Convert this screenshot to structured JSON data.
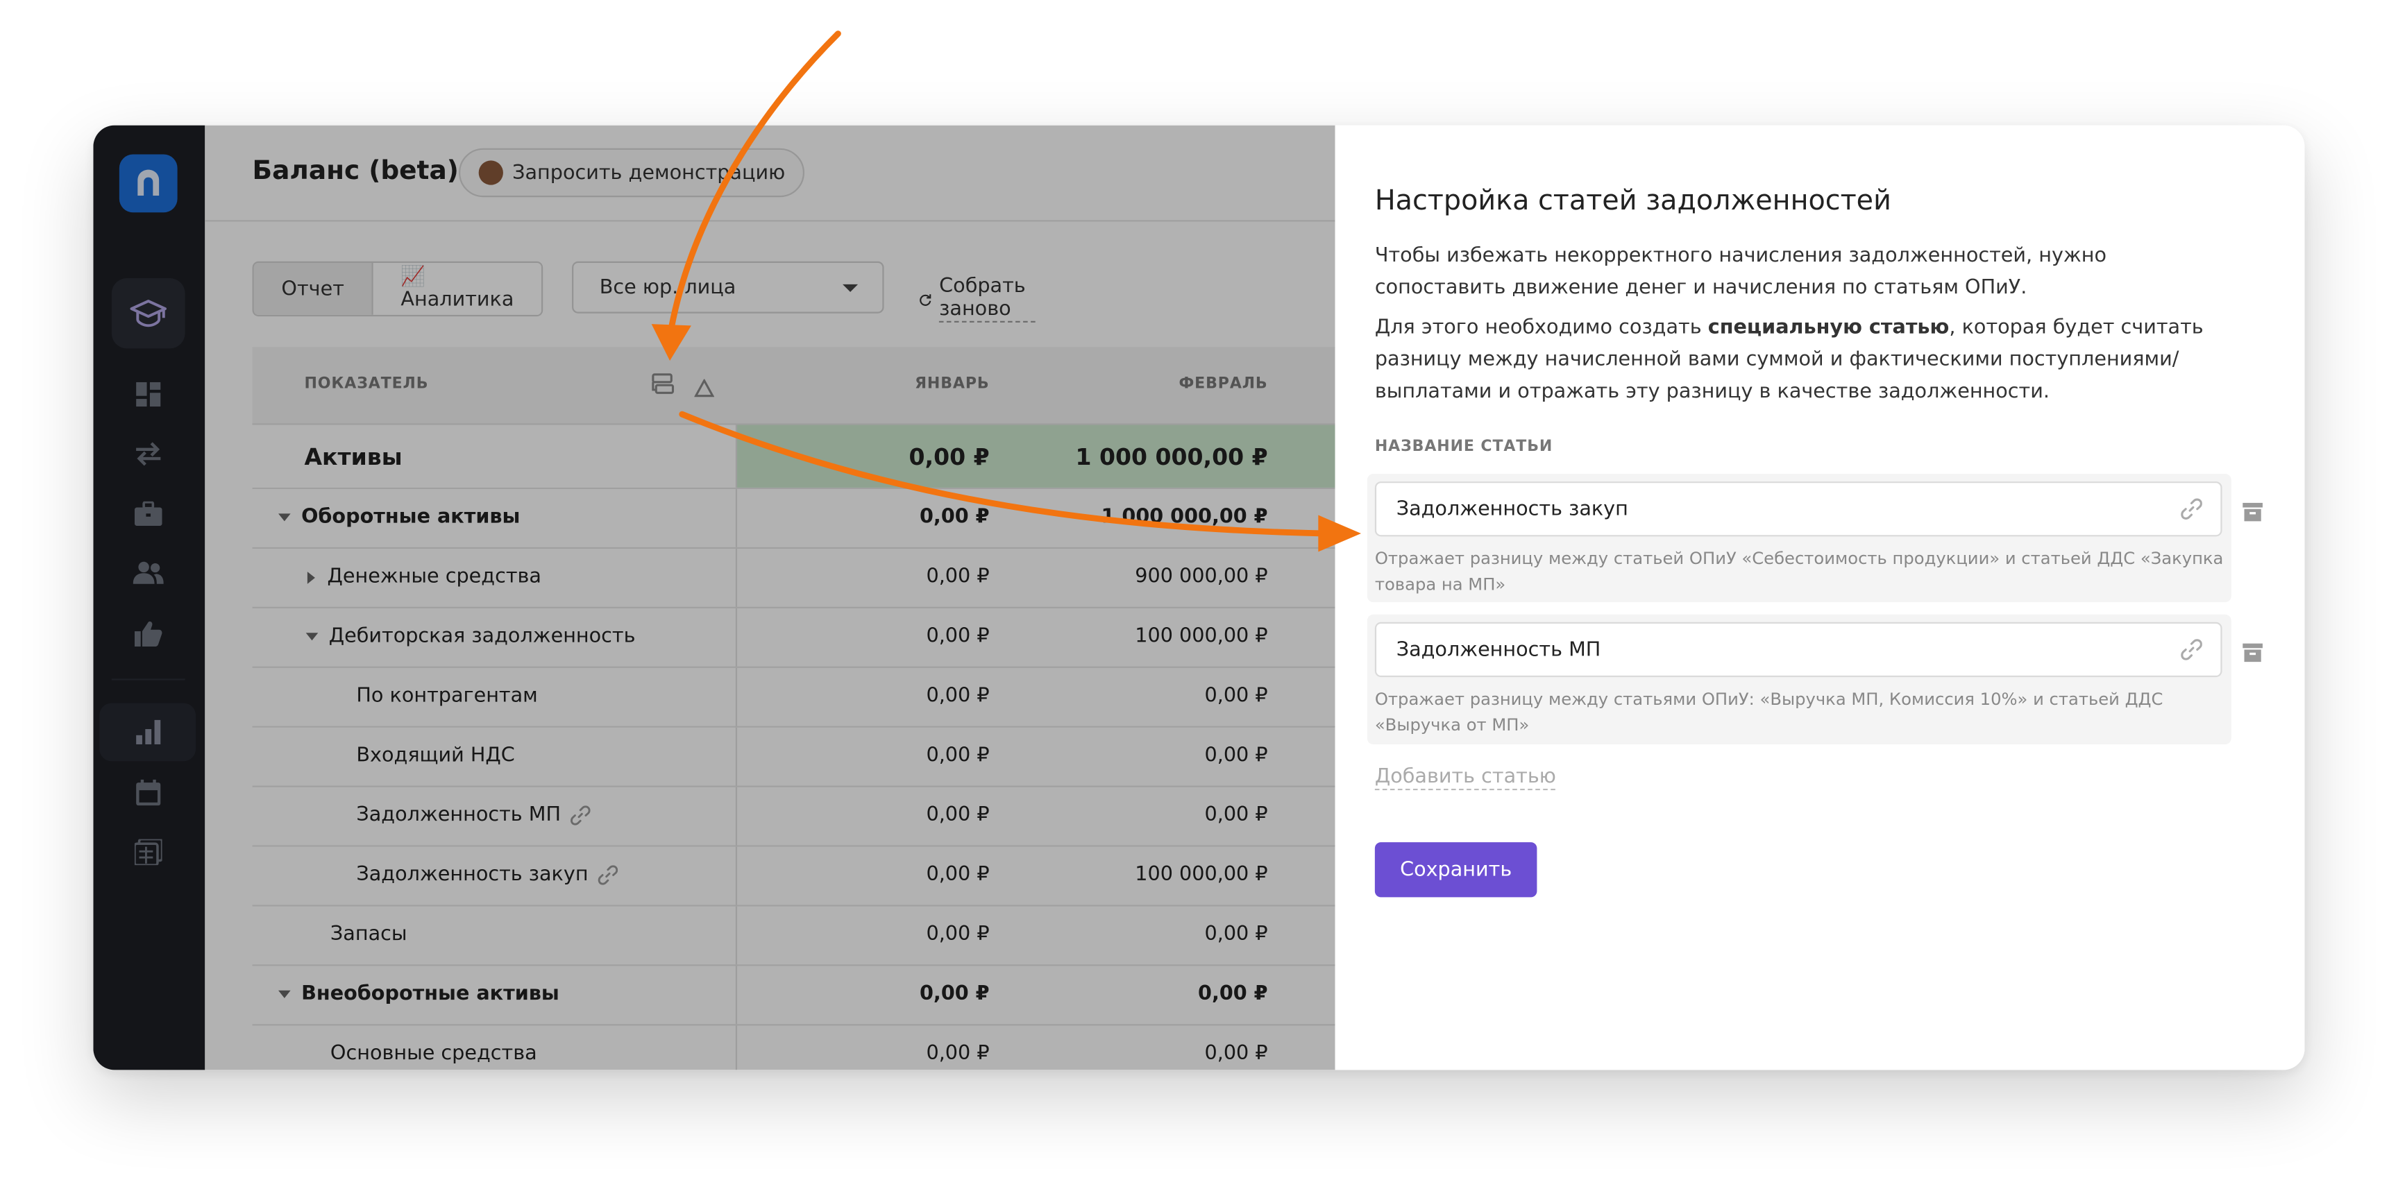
{
  "app": {
    "title": "Баланс (beta)",
    "demo_button": "Запросить демонстрацию"
  },
  "toolbar": {
    "tabs": [
      "Отчет",
      "📈 Аналитика"
    ],
    "entity_select": "Все юр. лица",
    "rebuild": "Собрать заново"
  },
  "table": {
    "headers": {
      "indicator": "ПОКАЗАТЕЛЬ",
      "col1": "ЯНВАРЬ",
      "col2": "ФЕВРАЛЬ"
    },
    "rows": [
      {
        "label": "Активы",
        "v1": "0,00 ₽",
        "v2": "1 000 000,00 ₽"
      },
      {
        "label": "Оборотные активы",
        "v1": "0,00 ₽",
        "v2": "1 000 000,00 ₽"
      },
      {
        "label": "Денежные средства",
        "v1": "0,00 ₽",
        "v2": "900 000,00 ₽"
      },
      {
        "label": "Дебиторская задолженность",
        "v1": "0,00 ₽",
        "v2": "100 000,00 ₽"
      },
      {
        "label": "По контрагентам",
        "v1": "0,00 ₽",
        "v2": "0,00 ₽"
      },
      {
        "label": "Входящий НДС",
        "v1": "0,00 ₽",
        "v2": "0,00 ₽"
      },
      {
        "label": "Задолженность МП",
        "v1": "0,00 ₽",
        "v2": "0,00 ₽"
      },
      {
        "label": "Задолженность закуп",
        "v1": "0,00 ₽",
        "v2": "100 000,00 ₽"
      },
      {
        "label": "Запасы",
        "v1": "0,00 ₽",
        "v2": "0,00 ₽"
      },
      {
        "label": "Внеоборотные активы",
        "v1": "0,00 ₽",
        "v2": "0,00 ₽"
      },
      {
        "label": "Основные средства",
        "v1": "0,00 ₽",
        "v2": "0,00 ₽"
      }
    ]
  },
  "panel": {
    "title": "Настройка статей задолженностей",
    "desc1": "Чтобы избежать некорректного начисления задолженностей, нужно сопоставить движение денег и начисления по статьям ОПиУ.",
    "desc2_pre": "Для этого необходимо создать ",
    "desc2_bold": "специальную статью",
    "desc2_post": ", которая будет считать разницу между начисленной вами суммой и фактическими поступлениями/выплатами и отражать эту разницу в качестве задолженности.",
    "field_label": "НАЗВАНИЕ СТАТЬИ",
    "items": [
      {
        "name": "Задолженность закуп",
        "hint": "Отражает разницу между статьей ОПиУ «Себестоимость продукции» и статьей ДДС «Закупка товара на МП»"
      },
      {
        "name": "Задолженность МП",
        "hint": "Отражает разницу между статьями ОПиУ: «Выручка МП, Комиссия 10%» и статьей ДДС «Выручка от МП»"
      }
    ],
    "add_link": "Добавить статью",
    "save_button": "Сохранить"
  },
  "colors": {
    "accent": "#6c4fd3",
    "arrow": "#f27410",
    "logo": "#1e6fd9",
    "highlight_row": "#cde8cf",
    "nav_bg": "#1d1f25"
  },
  "icons": [
    "logo-icon",
    "graduation-cap-icon",
    "dashboard-icon",
    "transfer-icon",
    "briefcase-icon",
    "users-icon",
    "thumbs-up-icon",
    "bar-chart-icon",
    "calendar-icon",
    "calculator-icon",
    "refresh-icon",
    "caret-down-icon",
    "columns-icon",
    "triangle-icon",
    "link-icon",
    "trash-icon"
  ]
}
